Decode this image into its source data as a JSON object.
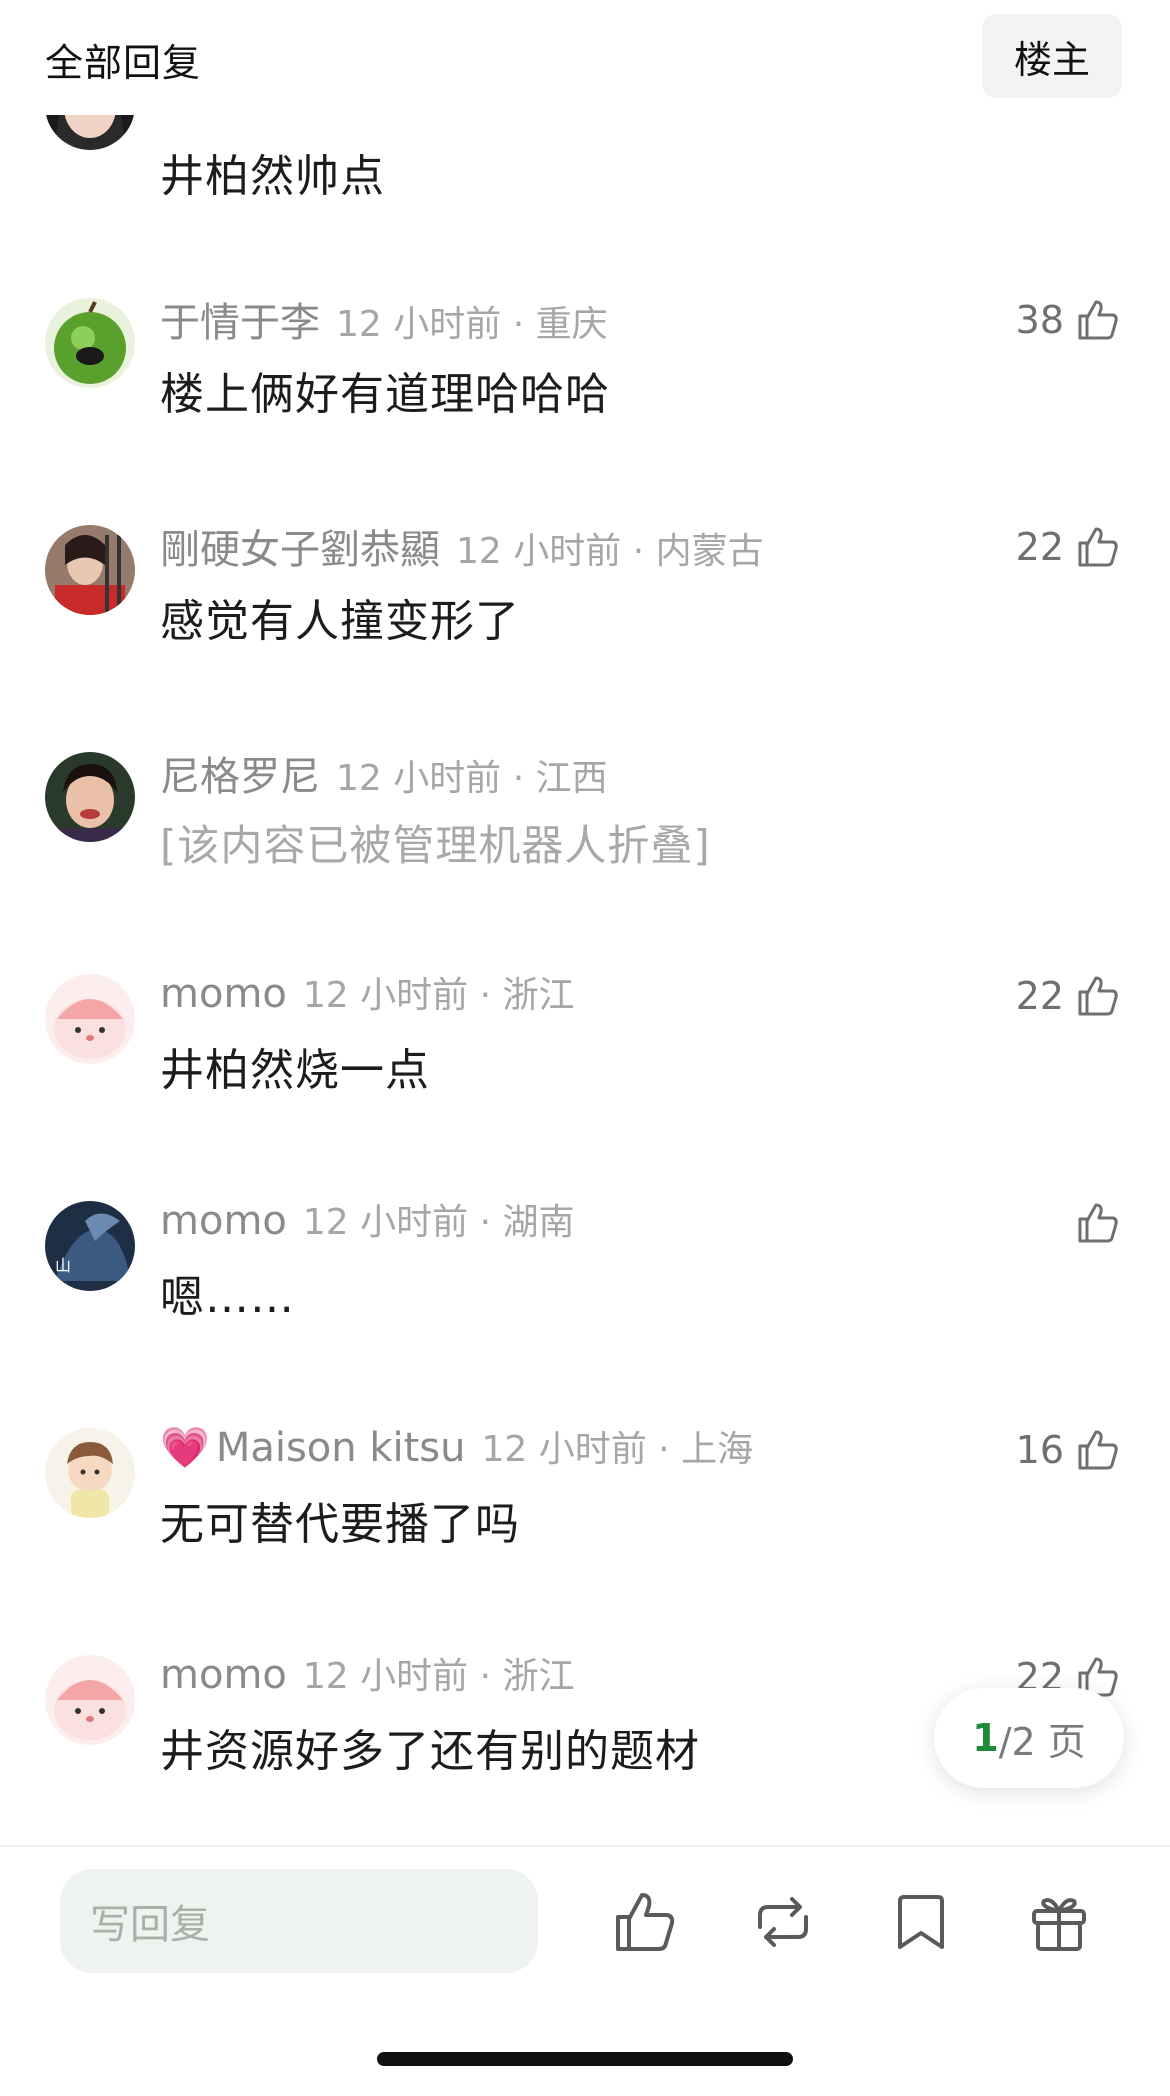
{
  "header": {
    "title": "全部回复",
    "owner_button": "楼主"
  },
  "comments": [
    {
      "id": "c0",
      "name": "",
      "time": "",
      "text": "井柏然帅点",
      "likes": ""
    },
    {
      "id": "c1",
      "name": "于情于李",
      "time": "12 小时前 · 重庆",
      "text": "楼上俩好有道理哈哈哈",
      "likes": "38"
    },
    {
      "id": "c2",
      "name": "剛硬女子劉恭顯",
      "time": "12 小时前 · 内蒙古",
      "text": "感觉有人撞变形了",
      "likes": "22"
    },
    {
      "id": "c3",
      "name": "尼格罗尼",
      "time": "12 小时前 · 江西",
      "text": "[该内容已被管理机器人折叠]",
      "likes": ""
    },
    {
      "id": "c4",
      "name": "momo",
      "time": "12 小时前 · 浙江",
      "text": "井柏然烧一点",
      "likes": "22"
    },
    {
      "id": "c5",
      "name": "momo",
      "time": "12 小时前 · 湖南",
      "text": "嗯……",
      "likes": ""
    },
    {
      "id": "c6",
      "name": "Maison kitsu",
      "time": "12 小时前 · 上海",
      "text": "无可替代要播了吗",
      "likes": "16",
      "badge": "💗"
    },
    {
      "id": "c7",
      "name": "momo",
      "time": "12 小时前 · 浙江",
      "text": "井资源好多了还有别的题材",
      "likes": "22"
    }
  ],
  "pager": {
    "current": "1",
    "total": "/2 页"
  },
  "bottom_bar": {
    "reply_placeholder": "写回复",
    "icons": [
      "thumbs-up-icon",
      "repost-icon",
      "bookmark-icon",
      "gift-icon"
    ]
  },
  "colors": {
    "accent": "#1f8a3a",
    "meta_gray": "#8a8a8a",
    "heart": "#e0529c"
  }
}
